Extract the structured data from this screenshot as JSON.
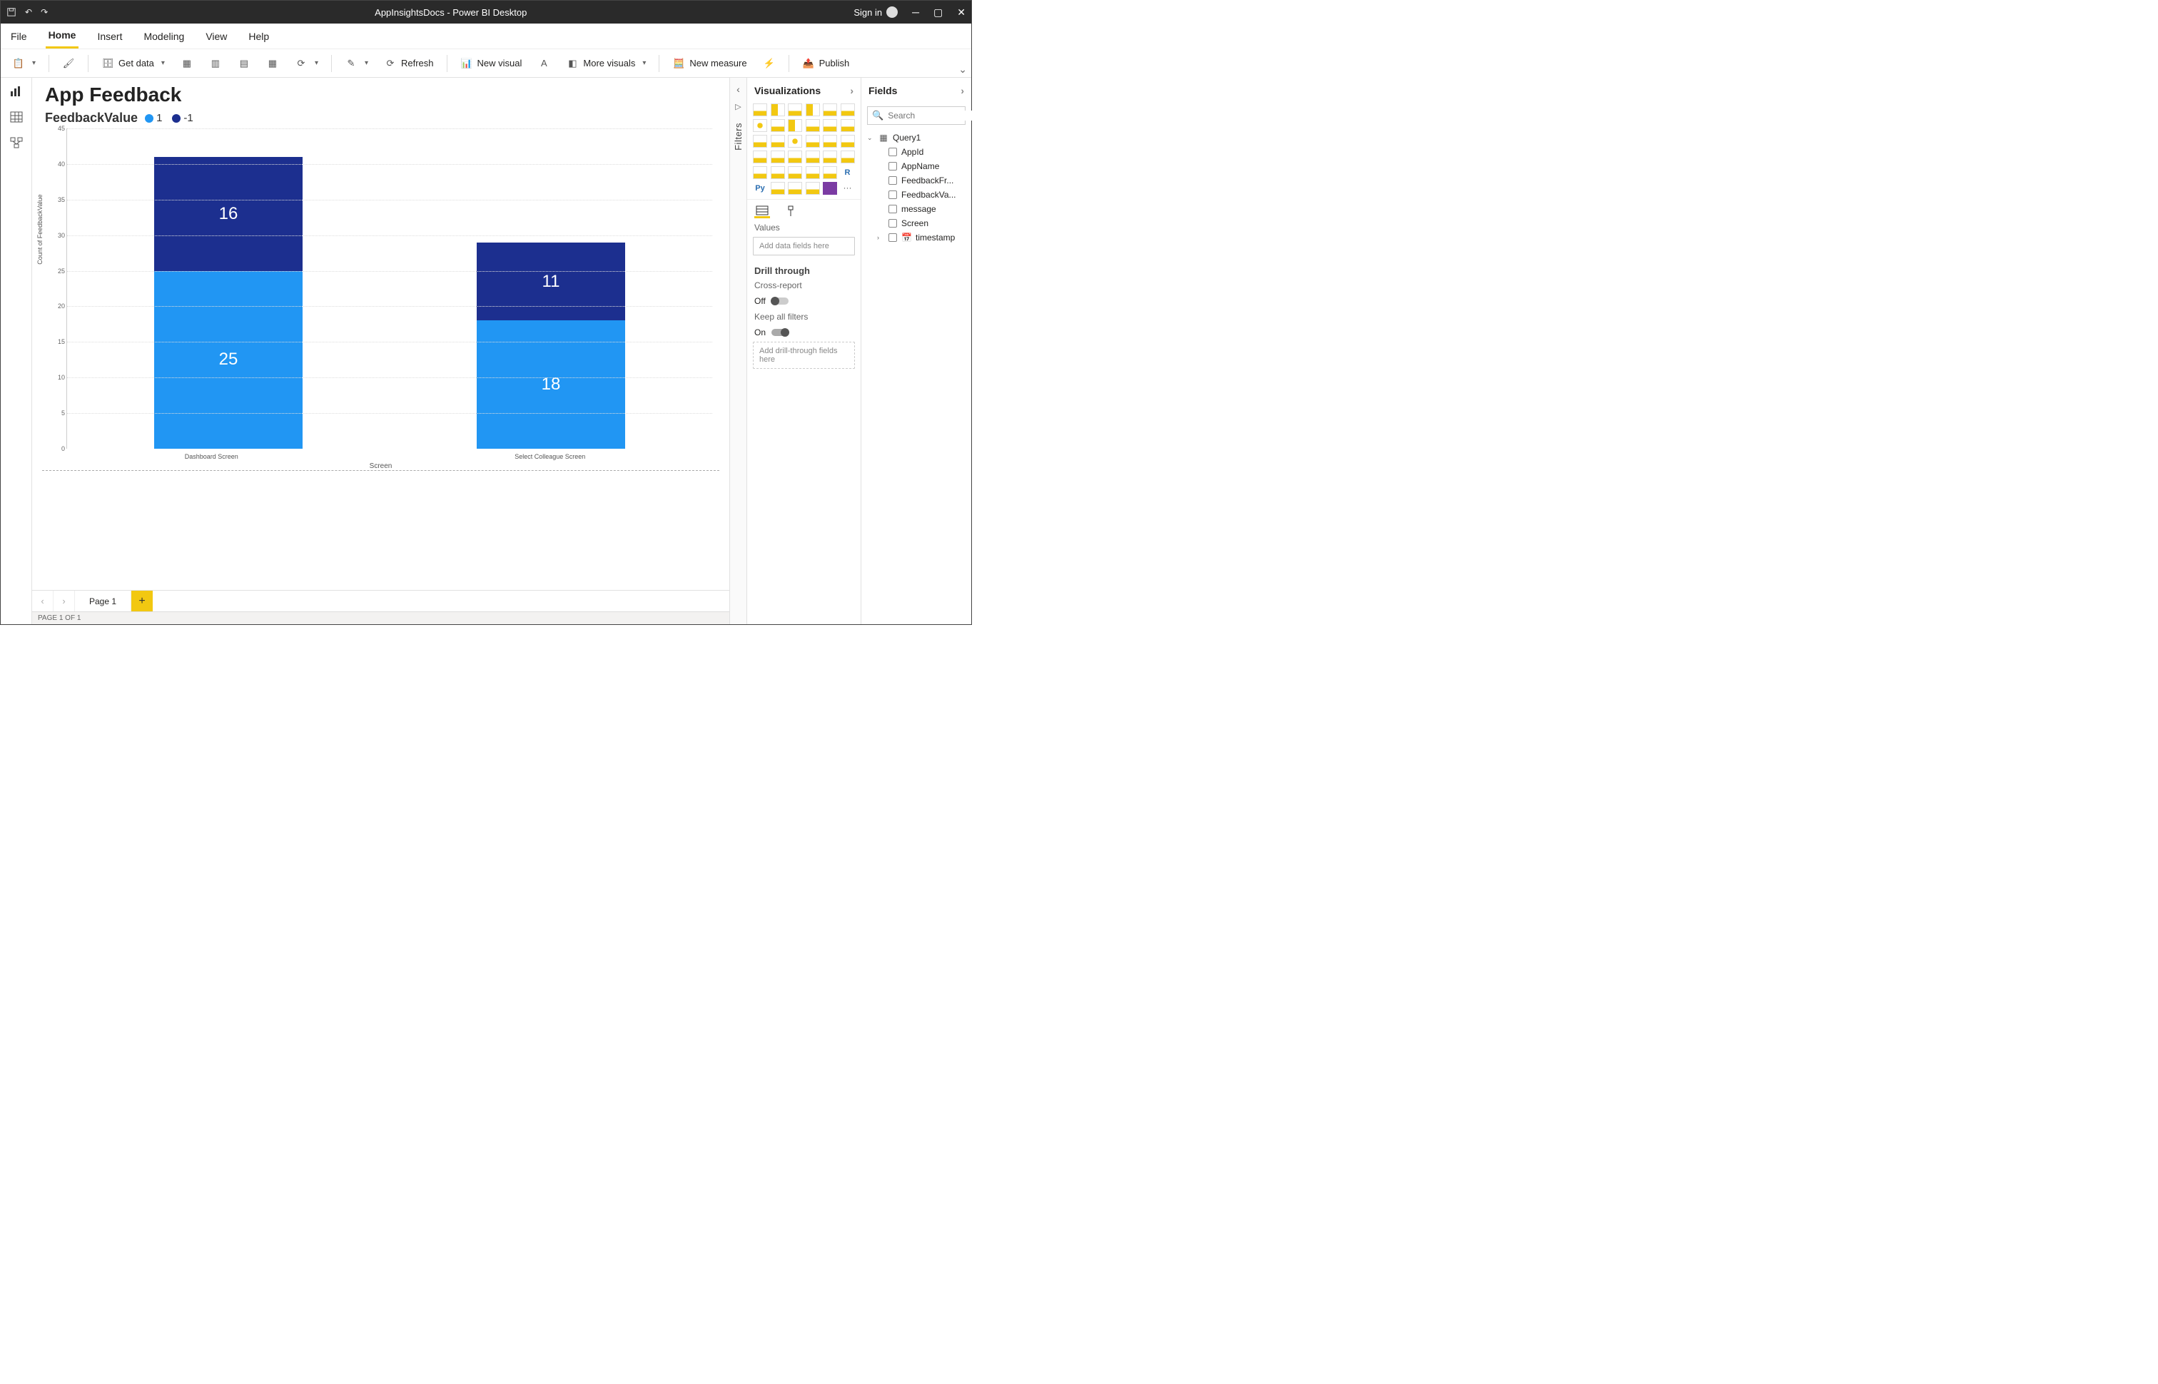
{
  "titlebar": {
    "title": "AppInsightsDocs - Power BI Desktop",
    "signin": "Sign in"
  },
  "menu": {
    "items": [
      "File",
      "Home",
      "Insert",
      "Modeling",
      "View",
      "Help"
    ],
    "active": "Home"
  },
  "ribbon": {
    "get_data": "Get data",
    "refresh": "Refresh",
    "new_visual": "New visual",
    "more_visuals": "More visuals",
    "new_measure": "New measure",
    "publish": "Publish"
  },
  "report": {
    "title": "App Feedback"
  },
  "chart": {
    "legend_title": "FeedbackValue",
    "legend_items": [
      {
        "label": "1",
        "color": "#2196f3"
      },
      {
        "label": "-1",
        "color": "#1c2f8f"
      }
    ]
  },
  "chart_data": {
    "type": "bar",
    "stacked": true,
    "title": "FeedbackValue",
    "xlabel": "Screen",
    "ylabel": "Count of FeedbackValue",
    "ylim": [
      0,
      45
    ],
    "yticks": [
      0,
      5,
      10,
      15,
      20,
      25,
      30,
      35,
      40,
      45
    ],
    "categories": [
      "Dashboard Screen",
      "Select Colleague Screen"
    ],
    "series": [
      {
        "name": "1",
        "color": "#2196f3",
        "values": [
          25,
          18
        ]
      },
      {
        "name": "-1",
        "color": "#1c2f8f",
        "values": [
          16,
          11
        ]
      }
    ]
  },
  "filters": {
    "label": "Filters"
  },
  "viz_pane": {
    "title": "Visualizations",
    "values_label": "Values",
    "values_placeholder": "Add data fields here",
    "drill_title": "Drill through",
    "cross_report": "Cross-report",
    "cross_report_state": "Off",
    "keep_filters": "Keep all filters",
    "keep_filters_state": "On",
    "drill_placeholder": "Add drill-through fields here"
  },
  "fields_pane": {
    "title": "Fields",
    "search_placeholder": "Search",
    "table": "Query1",
    "columns": [
      "AppId",
      "AppName",
      "FeedbackFr...",
      "FeedbackVa...",
      "message",
      "Screen",
      "timestamp"
    ]
  },
  "pages": {
    "current": "Page 1",
    "status": "PAGE 1 OF 1"
  }
}
